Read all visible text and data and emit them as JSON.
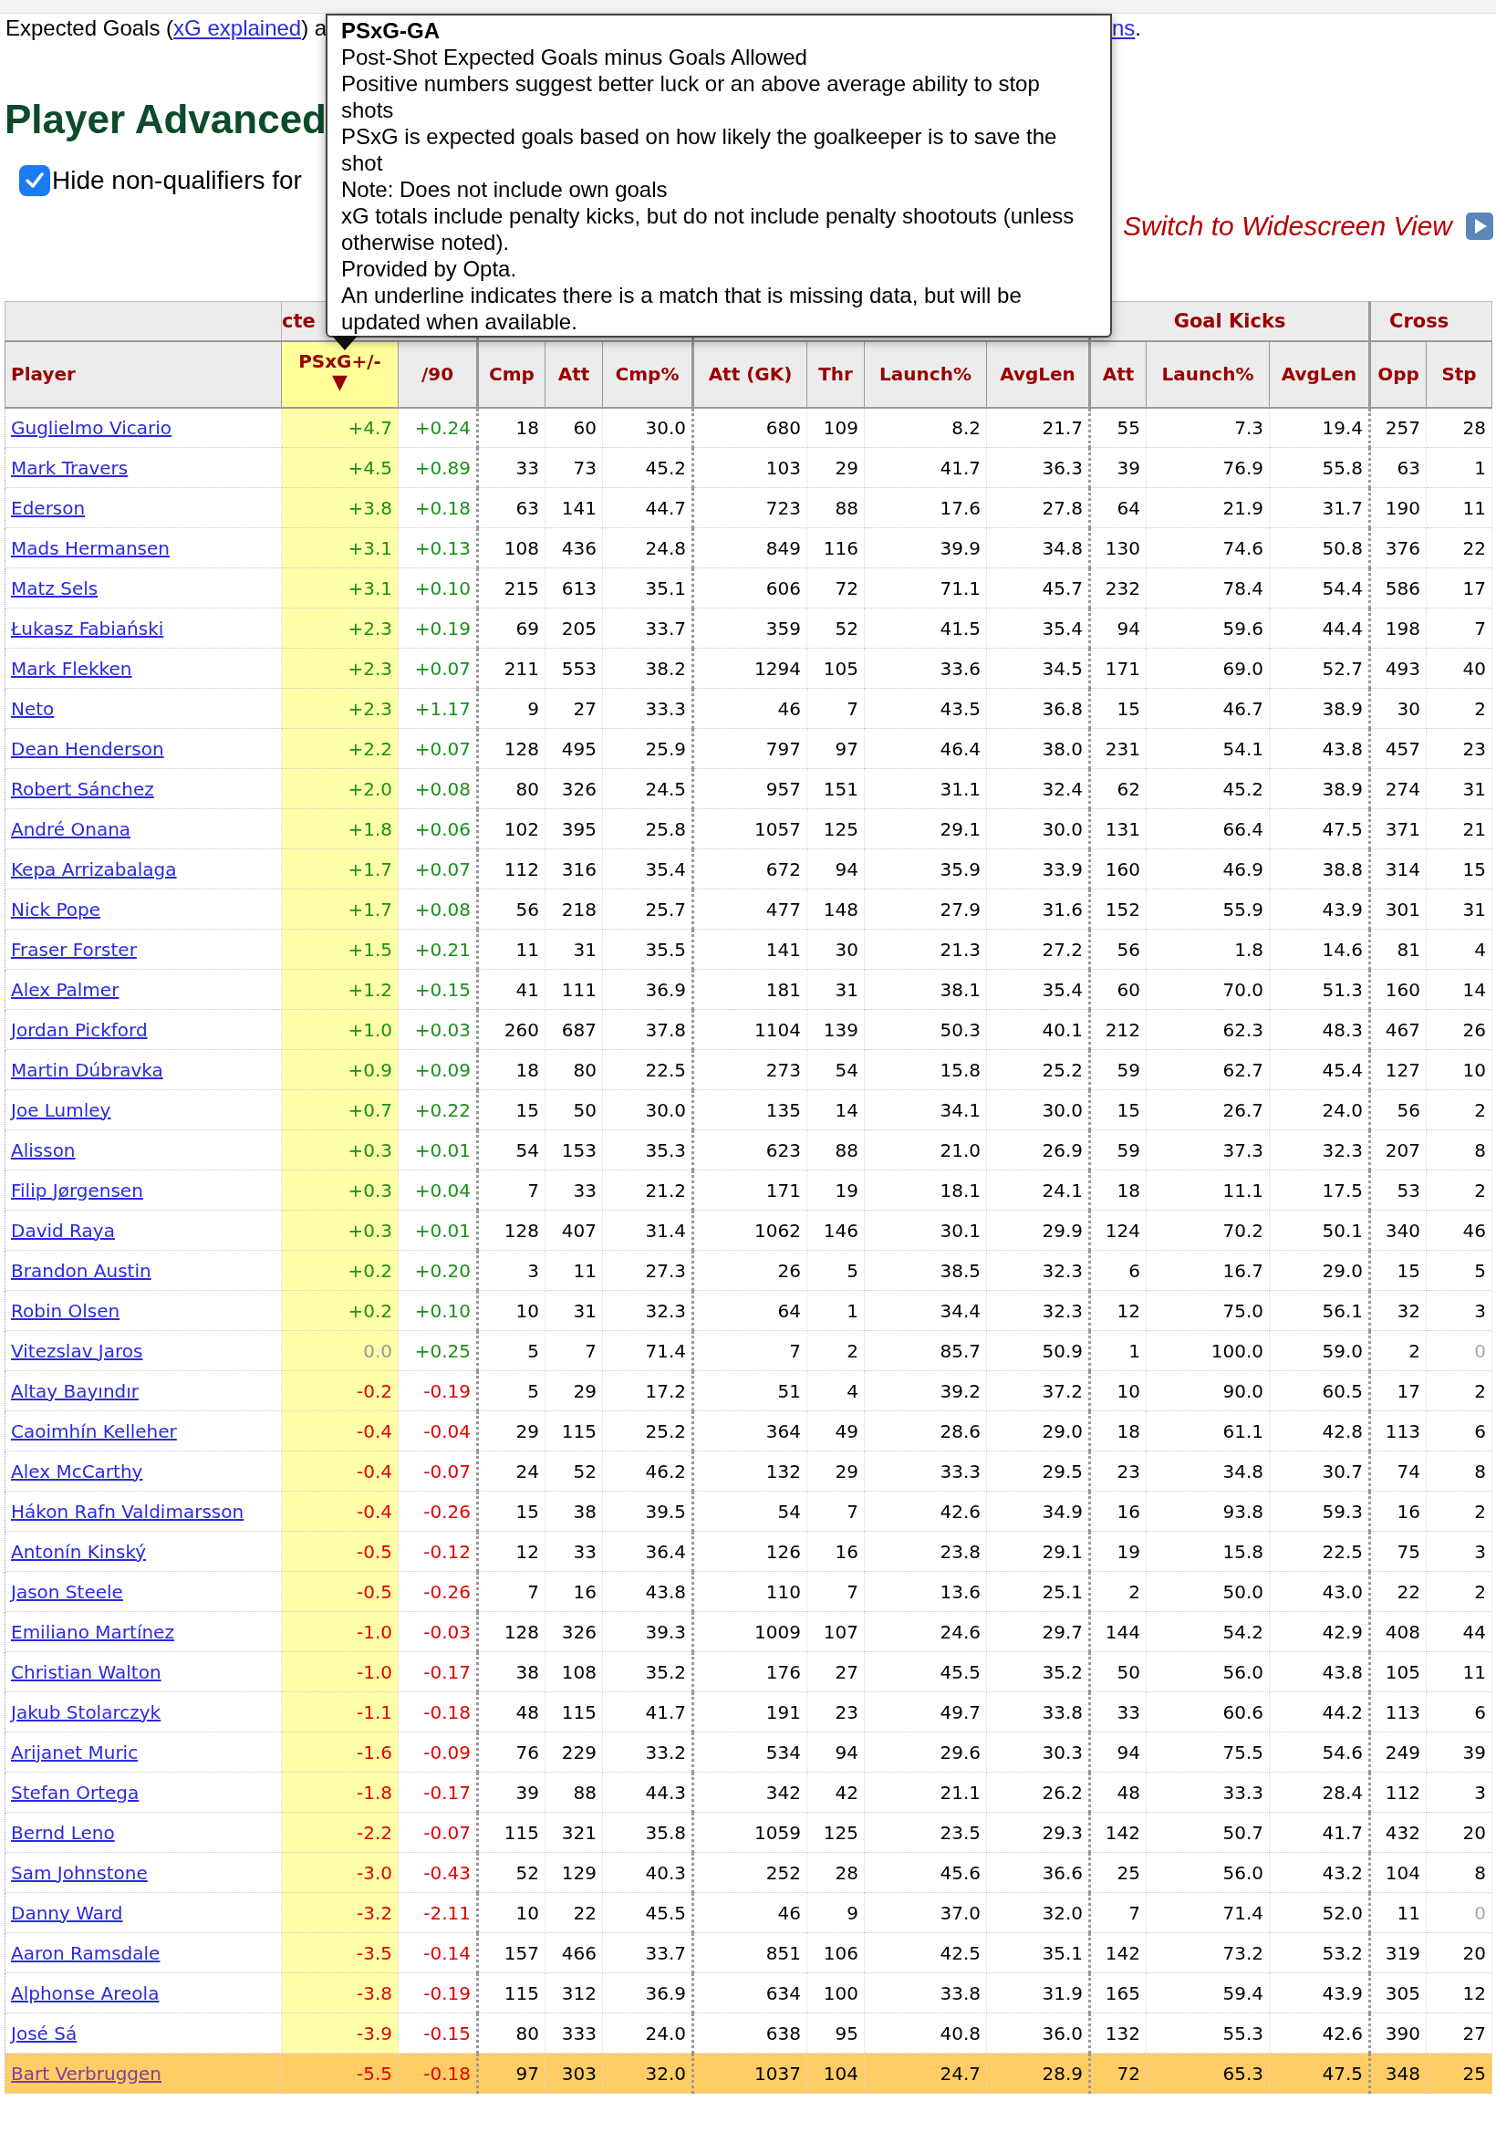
{
  "intro": {
    "before": "Expected Goals (",
    "link": "xG explained",
    "after": ") a",
    "link_right": "ns",
    "end": "."
  },
  "heading": "Player Advanced",
  "filter": {
    "label": "Hide non-qualifiers for",
    "checked": true
  },
  "widescreen_link": "Switch to Widescreen View",
  "tooltip": {
    "title": "PSxG-GA",
    "lines": [
      "Post-Shot Expected Goals minus Goals Allowed",
      "Positive numbers suggest better luck or an above average ability to stop shots",
      "PSxG is expected goals based on how likely the goalkeeper is to save the shot",
      "Note: Does not include own goals",
      "xG totals include penalty kicks, but do not include penalty shootouts (unless otherwise noted).",
      "Provided by Opta.",
      "An underline indicates there is a match that is missing data, but will be updated when available."
    ]
  },
  "table": {
    "groups": [
      {
        "label": "cte"
      },
      {
        "label": "Goal Kicks"
      },
      {
        "label": "Cross"
      }
    ],
    "columns": [
      {
        "label": "Player",
        "sorted": false
      },
      {
        "label": "PSxG+/-",
        "sorted": true,
        "sort_arrow": "▼"
      },
      {
        "label": "/90",
        "sorted": false
      },
      {
        "label": "Cmp",
        "sorted": false
      },
      {
        "label": "Att",
        "sorted": false
      },
      {
        "label": "Cmp%",
        "sorted": false
      },
      {
        "label": "Att (GK)",
        "sorted": false
      },
      {
        "label": "Thr",
        "sorted": false
      },
      {
        "label": "Launch%",
        "sorted": false
      },
      {
        "label": "AvgLen",
        "sorted": false
      },
      {
        "label": "Att",
        "sorted": false
      },
      {
        "label": "Launch%",
        "sorted": false
      },
      {
        "label": "AvgLen",
        "sorted": false
      },
      {
        "label": "Opp",
        "sorted": false
      },
      {
        "label": "Stp",
        "sorted": false
      }
    ],
    "rows": [
      {
        "player": "Guglielmo Vicario",
        "psxg": {
          "text": "+4.7",
          "color": "#1a8f1a"
        },
        "per90": {
          "text": "+0.24",
          "color": "#1a8f1a"
        },
        "highlighted": false,
        "stats": [
          "18",
          "60",
          "30.0",
          "680",
          "109",
          "8.2",
          "21.7",
          "55",
          "7.3",
          "19.4",
          "257",
          "28"
        ]
      },
      {
        "player": "Mark Travers",
        "psxg": {
          "text": "+4.5",
          "color": "#1a8f1a"
        },
        "per90": {
          "text": "+0.89",
          "color": "#1a8f1a"
        },
        "highlighted": false,
        "stats": [
          "33",
          "73",
          "45.2",
          "103",
          "29",
          "41.7",
          "36.3",
          "39",
          "76.9",
          "55.8",
          "63",
          "1"
        ]
      },
      {
        "player": "Ederson",
        "psxg": {
          "text": "+3.8",
          "color": "#1a8f1a"
        },
        "per90": {
          "text": "+0.18",
          "color": "#1a8f1a"
        },
        "highlighted": false,
        "stats": [
          "63",
          "141",
          "44.7",
          "723",
          "88",
          "17.6",
          "27.8",
          "64",
          "21.9",
          "31.7",
          "190",
          "11"
        ]
      },
      {
        "player": "Mads Hermansen",
        "psxg": {
          "text": "+3.1",
          "color": "#1a8f1a"
        },
        "per90": {
          "text": "+0.13",
          "color": "#1a8f1a"
        },
        "highlighted": false,
        "stats": [
          "108",
          "436",
          "24.8",
          "849",
          "116",
          "39.9",
          "34.8",
          "130",
          "74.6",
          "50.8",
          "376",
          "22"
        ]
      },
      {
        "player": "Matz Sels",
        "psxg": {
          "text": "+3.1",
          "color": "#1a8f1a"
        },
        "per90": {
          "text": "+0.10",
          "color": "#1a8f1a"
        },
        "highlighted": false,
        "stats": [
          "215",
          "613",
          "35.1",
          "606",
          "72",
          "71.1",
          "45.7",
          "232",
          "78.4",
          "54.4",
          "586",
          "17"
        ]
      },
      {
        "player": "Łukasz Fabiański",
        "psxg": {
          "text": "+2.3",
          "color": "#1a8f1a"
        },
        "per90": {
          "text": "+0.19",
          "color": "#1a8f1a"
        },
        "highlighted": false,
        "stats": [
          "69",
          "205",
          "33.7",
          "359",
          "52",
          "41.5",
          "35.4",
          "94",
          "59.6",
          "44.4",
          "198",
          "7"
        ]
      },
      {
        "player": "Mark Flekken",
        "psxg": {
          "text": "+2.3",
          "color": "#1a8f1a"
        },
        "per90": {
          "text": "+0.07",
          "color": "#1a8f1a"
        },
        "highlighted": false,
        "stats": [
          "211",
          "553",
          "38.2",
          "1294",
          "105",
          "33.6",
          "34.5",
          "171",
          "69.0",
          "52.7",
          "493",
          "40"
        ]
      },
      {
        "player": "Neto",
        "psxg": {
          "text": "+2.3",
          "color": "#1a8f1a"
        },
        "per90": {
          "text": "+1.17",
          "color": "#1a8f1a"
        },
        "highlighted": false,
        "stats": [
          "9",
          "27",
          "33.3",
          "46",
          "7",
          "43.5",
          "36.8",
          "15",
          "46.7",
          "38.9",
          "30",
          "2"
        ]
      },
      {
        "player": "Dean Henderson",
        "psxg": {
          "text": "+2.2",
          "color": "#1a8f1a"
        },
        "per90": {
          "text": "+0.07",
          "color": "#1a8f1a"
        },
        "highlighted": false,
        "stats": [
          "128",
          "495",
          "25.9",
          "797",
          "97",
          "46.4",
          "38.0",
          "231",
          "54.1",
          "43.8",
          "457",
          "23"
        ]
      },
      {
        "player": "Robert Sánchez",
        "psxg": {
          "text": "+2.0",
          "color": "#1a8f1a"
        },
        "per90": {
          "text": "+0.08",
          "color": "#1a8f1a"
        },
        "highlighted": false,
        "stats": [
          "80",
          "326",
          "24.5",
          "957",
          "151",
          "31.1",
          "32.4",
          "62",
          "45.2",
          "38.9",
          "274",
          "31"
        ]
      },
      {
        "player": "André Onana",
        "psxg": {
          "text": "+1.8",
          "color": "#1a8f1a"
        },
        "per90": {
          "text": "+0.06",
          "color": "#1a8f1a"
        },
        "highlighted": false,
        "stats": [
          "102",
          "395",
          "25.8",
          "1057",
          "125",
          "29.1",
          "30.0",
          "131",
          "66.4",
          "47.5",
          "371",
          "21"
        ]
      },
      {
        "player": "Kepa Arrizabalaga",
        "psxg": {
          "text": "+1.7",
          "color": "#1a8f1a"
        },
        "per90": {
          "text": "+0.07",
          "color": "#1a8f1a"
        },
        "highlighted": false,
        "stats": [
          "112",
          "316",
          "35.4",
          "672",
          "94",
          "35.9",
          "33.9",
          "160",
          "46.9",
          "38.8",
          "314",
          "15"
        ]
      },
      {
        "player": "Nick Pope",
        "psxg": {
          "text": "+1.7",
          "color": "#1a8f1a"
        },
        "per90": {
          "text": "+0.08",
          "color": "#1a8f1a"
        },
        "highlighted": false,
        "stats": [
          "56",
          "218",
          "25.7",
          "477",
          "148",
          "27.9",
          "31.6",
          "152",
          "55.9",
          "43.9",
          "301",
          "31"
        ]
      },
      {
        "player": "Fraser Forster",
        "psxg": {
          "text": "+1.5",
          "color": "#1a8f1a"
        },
        "per90": {
          "text": "+0.21",
          "color": "#1a8f1a"
        },
        "highlighted": false,
        "stats": [
          "11",
          "31",
          "35.5",
          "141",
          "30",
          "21.3",
          "27.2",
          "56",
          "1.8",
          "14.6",
          "81",
          "4"
        ]
      },
      {
        "player": "Alex Palmer",
        "psxg": {
          "text": "+1.2",
          "color": "#1a8f1a"
        },
        "per90": {
          "text": "+0.15",
          "color": "#1a8f1a"
        },
        "highlighted": false,
        "stats": [
          "41",
          "111",
          "36.9",
          "181",
          "31",
          "38.1",
          "35.4",
          "60",
          "70.0",
          "51.3",
          "160",
          "14"
        ]
      },
      {
        "player": "Jordan Pickford",
        "psxg": {
          "text": "+1.0",
          "color": "#1a8f1a"
        },
        "per90": {
          "text": "+0.03",
          "color": "#1a8f1a"
        },
        "highlighted": false,
        "stats": [
          "260",
          "687",
          "37.8",
          "1104",
          "139",
          "50.3",
          "40.1",
          "212",
          "62.3",
          "48.3",
          "467",
          "26"
        ]
      },
      {
        "player": "Martin Dúbravka",
        "psxg": {
          "text": "+0.9",
          "color": "#1a8f1a"
        },
        "per90": {
          "text": "+0.09",
          "color": "#1a8f1a"
        },
        "highlighted": false,
        "stats": [
          "18",
          "80",
          "22.5",
          "273",
          "54",
          "15.8",
          "25.2",
          "59",
          "62.7",
          "45.4",
          "127",
          "10"
        ]
      },
      {
        "player": "Joe Lumley",
        "psxg": {
          "text": "+0.7",
          "color": "#1a8f1a"
        },
        "per90": {
          "text": "+0.22",
          "color": "#1a8f1a"
        },
        "highlighted": false,
        "stats": [
          "15",
          "50",
          "30.0",
          "135",
          "14",
          "34.1",
          "30.0",
          "15",
          "26.7",
          "24.0",
          "56",
          "2"
        ]
      },
      {
        "player": "Alisson",
        "psxg": {
          "text": "+0.3",
          "color": "#1a8f1a"
        },
        "per90": {
          "text": "+0.01",
          "color": "#1a8f1a"
        },
        "highlighted": false,
        "stats": [
          "54",
          "153",
          "35.3",
          "623",
          "88",
          "21.0",
          "26.9",
          "59",
          "37.3",
          "32.3",
          "207",
          "8"
        ]
      },
      {
        "player": "Filip Jørgensen",
        "psxg": {
          "text": "+0.3",
          "color": "#1a8f1a"
        },
        "per90": {
          "text": "+0.04",
          "color": "#1a8f1a"
        },
        "highlighted": false,
        "stats": [
          "7",
          "33",
          "21.2",
          "171",
          "19",
          "18.1",
          "24.1",
          "18",
          "11.1",
          "17.5",
          "53",
          "2"
        ]
      },
      {
        "player": "David Raya",
        "psxg": {
          "text": "+0.3",
          "color": "#1a8f1a"
        },
        "per90": {
          "text": "+0.01",
          "color": "#1a8f1a"
        },
        "highlighted": false,
        "stats": [
          "128",
          "407",
          "31.4",
          "1062",
          "146",
          "30.1",
          "29.9",
          "124",
          "70.2",
          "50.1",
          "340",
          "46"
        ]
      },
      {
        "player": "Brandon Austin",
        "psxg": {
          "text": "+0.2",
          "color": "#1a8f1a"
        },
        "per90": {
          "text": "+0.20",
          "color": "#1a8f1a"
        },
        "highlighted": false,
        "stats": [
          "3",
          "11",
          "27.3",
          "26",
          "5",
          "38.5",
          "32.3",
          "6",
          "16.7",
          "29.0",
          "15",
          "5"
        ]
      },
      {
        "player": "Robin Olsen",
        "psxg": {
          "text": "+0.2",
          "color": "#1a8f1a"
        },
        "per90": {
          "text": "+0.10",
          "color": "#1a8f1a"
        },
        "highlighted": false,
        "stats": [
          "10",
          "31",
          "32.3",
          "64",
          "1",
          "34.4",
          "32.3",
          "12",
          "75.0",
          "56.1",
          "32",
          "3"
        ]
      },
      {
        "player": "Vitezslav Jaros",
        "psxg": {
          "text": "0.0",
          "color": "#999999"
        },
        "per90": {
          "text": "+0.25",
          "color": "#1a8f1a"
        },
        "highlighted": false,
        "stats": [
          "5",
          "7",
          "71.4",
          "7",
          "2",
          "85.7",
          "50.9",
          "1",
          "100.0",
          "59.0",
          "2",
          {
            "text": "0",
            "muted": true
          }
        ]
      },
      {
        "player": "Altay Bayındır",
        "psxg": {
          "text": "-0.2",
          "color": "#e00000"
        },
        "per90": {
          "text": "-0.19",
          "color": "#e00000"
        },
        "highlighted": false,
        "stats": [
          "5",
          "29",
          "17.2",
          "51",
          "4",
          "39.2",
          "37.2",
          "10",
          "90.0",
          "60.5",
          "17",
          "2"
        ]
      },
      {
        "player": "Caoimhín Kelleher",
        "psxg": {
          "text": "-0.4",
          "color": "#e00000"
        },
        "per90": {
          "text": "-0.04",
          "color": "#e00000"
        },
        "highlighted": false,
        "stats": [
          "29",
          "115",
          "25.2",
          "364",
          "49",
          "28.6",
          "29.0",
          "18",
          "61.1",
          "42.8",
          "113",
          "6"
        ]
      },
      {
        "player": "Alex McCarthy",
        "psxg": {
          "text": "-0.4",
          "color": "#e00000"
        },
        "per90": {
          "text": "-0.07",
          "color": "#e00000"
        },
        "highlighted": false,
        "stats": [
          "24",
          "52",
          "46.2",
          "132",
          "29",
          "33.3",
          "29.5",
          "23",
          "34.8",
          "30.7",
          "74",
          "8"
        ]
      },
      {
        "player": "Hákon Rafn Valdimarsson",
        "psxg": {
          "text": "-0.4",
          "color": "#e00000"
        },
        "per90": {
          "text": "-0.26",
          "color": "#e00000"
        },
        "highlighted": false,
        "stats": [
          "15",
          "38",
          "39.5",
          "54",
          "7",
          "42.6",
          "34.9",
          "16",
          "93.8",
          "59.3",
          "16",
          "2"
        ]
      },
      {
        "player": "Antonín Kinský",
        "psxg": {
          "text": "-0.5",
          "color": "#e00000"
        },
        "per90": {
          "text": "-0.12",
          "color": "#e00000"
        },
        "highlighted": false,
        "stats": [
          "12",
          "33",
          "36.4",
          "126",
          "16",
          "23.8",
          "29.1",
          "19",
          "15.8",
          "22.5",
          "75",
          "3"
        ]
      },
      {
        "player": "Jason Steele",
        "psxg": {
          "text": "-0.5",
          "color": "#e00000"
        },
        "per90": {
          "text": "-0.26",
          "color": "#e00000"
        },
        "highlighted": false,
        "stats": [
          "7",
          "16",
          "43.8",
          "110",
          "7",
          "13.6",
          "25.1",
          "2",
          "50.0",
          "43.0",
          "22",
          "2"
        ]
      },
      {
        "player": "Emiliano Martínez",
        "psxg": {
          "text": "-1.0",
          "color": "#e00000"
        },
        "per90": {
          "text": "-0.03",
          "color": "#e00000"
        },
        "highlighted": false,
        "stats": [
          "128",
          "326",
          "39.3",
          "1009",
          "107",
          "24.6",
          "29.7",
          "144",
          "54.2",
          "42.9",
          "408",
          "44"
        ]
      },
      {
        "player": "Christian Walton",
        "psxg": {
          "text": "-1.0",
          "color": "#e00000"
        },
        "per90": {
          "text": "-0.17",
          "color": "#e00000"
        },
        "highlighted": false,
        "stats": [
          "38",
          "108",
          "35.2",
          "176",
          "27",
          "45.5",
          "35.2",
          "50",
          "56.0",
          "43.8",
          "105",
          "11"
        ]
      },
      {
        "player": "Jakub Stolarczyk",
        "psxg": {
          "text": "-1.1",
          "color": "#e00000"
        },
        "per90": {
          "text": "-0.18",
          "color": "#e00000"
        },
        "highlighted": false,
        "stats": [
          "48",
          "115",
          "41.7",
          "191",
          "23",
          "49.7",
          "33.8",
          "33",
          "60.6",
          "44.2",
          "113",
          "6"
        ]
      },
      {
        "player": "Arijanet Muric",
        "psxg": {
          "text": "-1.6",
          "color": "#e00000"
        },
        "per90": {
          "text": "-0.09",
          "color": "#e00000"
        },
        "highlighted": false,
        "stats": [
          "76",
          "229",
          "33.2",
          "534",
          "94",
          "29.6",
          "30.3",
          "94",
          "75.5",
          "54.6",
          "249",
          "39"
        ]
      },
      {
        "player": "Stefan Ortega",
        "psxg": {
          "text": "-1.8",
          "color": "#e00000"
        },
        "per90": {
          "text": "-0.17",
          "color": "#e00000"
        },
        "highlighted": false,
        "stats": [
          "39",
          "88",
          "44.3",
          "342",
          "42",
          "21.1",
          "26.2",
          "48",
          "33.3",
          "28.4",
          "112",
          "3"
        ]
      },
      {
        "player": "Bernd Leno",
        "psxg": {
          "text": "-2.2",
          "color": "#e00000"
        },
        "per90": {
          "text": "-0.07",
          "color": "#e00000"
        },
        "highlighted": false,
        "stats": [
          "115",
          "321",
          "35.8",
          "1059",
          "125",
          "23.5",
          "29.3",
          "142",
          "50.7",
          "41.7",
          "432",
          "20"
        ]
      },
      {
        "player": "Sam Johnstone",
        "psxg": {
          "text": "-3.0",
          "color": "#e00000"
        },
        "per90": {
          "text": "-0.43",
          "color": "#e00000"
        },
        "highlighted": false,
        "stats": [
          "52",
          "129",
          "40.3",
          "252",
          "28",
          "45.6",
          "36.6",
          "25",
          "56.0",
          "43.2",
          "104",
          "8"
        ]
      },
      {
        "player": "Danny Ward",
        "psxg": {
          "text": "-3.2",
          "color": "#e00000"
        },
        "per90": {
          "text": "-2.11",
          "color": "#e00000"
        },
        "highlighted": false,
        "stats": [
          "10",
          "22",
          "45.5",
          "46",
          "9",
          "37.0",
          "32.0",
          "7",
          "71.4",
          "52.0",
          "11",
          {
            "text": "0",
            "muted": true
          }
        ]
      },
      {
        "player": "Aaron Ramsdale",
        "psxg": {
          "text": "-3.5",
          "color": "#e00000"
        },
        "per90": {
          "text": "-0.14",
          "color": "#e00000"
        },
        "highlighted": false,
        "stats": [
          "157",
          "466",
          "33.7",
          "851",
          "106",
          "42.5",
          "35.1",
          "142",
          "73.2",
          "53.2",
          "319",
          "20"
        ]
      },
      {
        "player": "Alphonse Areola",
        "psxg": {
          "text": "-3.8",
          "color": "#e00000"
        },
        "per90": {
          "text": "-0.19",
          "color": "#e00000"
        },
        "highlighted": false,
        "stats": [
          "115",
          "312",
          "36.9",
          "634",
          "100",
          "33.8",
          "31.9",
          "165",
          "59.4",
          "43.9",
          "305",
          "12"
        ]
      },
      {
        "player": "José Sá",
        "psxg": {
          "text": "-3.9",
          "color": "#e00000"
        },
        "per90": {
          "text": "-0.15",
          "color": "#e00000"
        },
        "highlighted": false,
        "stats": [
          "80",
          "333",
          "24.0",
          "638",
          "95",
          "40.8",
          "36.0",
          "132",
          "55.3",
          "42.6",
          "390",
          "27"
        ]
      },
      {
        "player": "Bart Verbruggen",
        "psxg": {
          "text": "-5.5",
          "color": "#e00000"
        },
        "per90": {
          "text": "-0.18",
          "color": "#e00000"
        },
        "highlighted": true,
        "stats": [
          "97",
          "303",
          "32.0",
          "1037",
          "104",
          "24.7",
          "28.9",
          "72",
          "65.3",
          "47.5",
          "348",
          "25"
        ]
      }
    ]
  }
}
